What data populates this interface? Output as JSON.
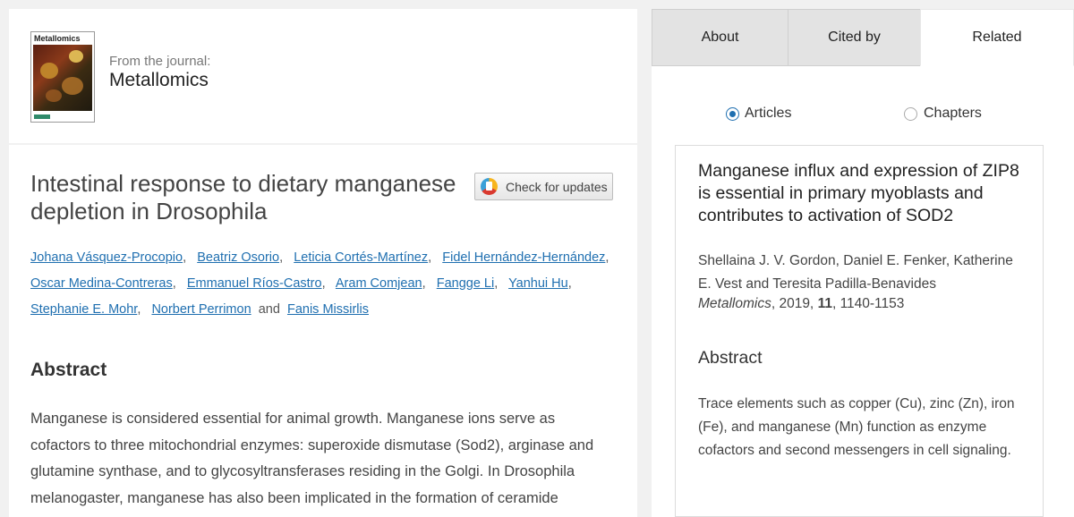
{
  "journal": {
    "cover_title": "Metallomics",
    "from_label": "From the journal:",
    "name": "Metallomics"
  },
  "article": {
    "title": "Intestinal response to dietary manganese depletion in Drosophila",
    "check_updates_label": "Check for updates",
    "authors": [
      "Johana Vásquez-Procopio",
      "Beatriz Osorio",
      "Leticia Cortés-Martínez",
      "Fidel Hernández-Hernández",
      "Oscar Medina-Contreras",
      "Emmanuel Ríos-Castro",
      "Aram Comjean",
      "Fangge Li",
      "Yanhui Hu",
      "Stephanie E. Mohr",
      "Norbert Perrimon",
      "Fanis Missirlis"
    ],
    "author_separator": ",",
    "author_and": "and",
    "abstract_heading": "Abstract",
    "abstract_text": "Manganese is considered essential for animal growth. Manganese ions serve as cofactors to three mitochondrial enzymes: superoxide dismutase (Sod2), arginase and glutamine synthase, and to glycosyltransferases residing in the Golgi. In Drosophila melanogaster, manganese has also been implicated in the formation of ceramide"
  },
  "sidebar": {
    "tabs": [
      "About",
      "Cited by",
      "Related"
    ],
    "active_tab": "Related",
    "radio_options": [
      "Articles",
      "Chapters"
    ],
    "selected_option": "Articles",
    "related": {
      "title": "Manganese influx and expression of ZIP8 is essential in primary myoblasts and contributes to activation of SOD2",
      "authors": "Shellaina J. V. Gordon, Daniel E. Fenker, Katherine E. Vest and Teresita Padilla-Benavides",
      "journal": "Metallomics",
      "year": "2019,",
      "volume": "11",
      "pages": ", 1140-1153",
      "abstract_heading": "Abstract",
      "abstract_text": "Trace elements such as copper (Cu), zinc (Zn), iron (Fe), and manganese (Mn) function as enzyme cofactors and second messengers in cell signaling."
    }
  },
  "colors": {
    "link": "#1f6fb0",
    "background": "#f1f1f1",
    "tab_inactive": "#e3e3e3"
  }
}
